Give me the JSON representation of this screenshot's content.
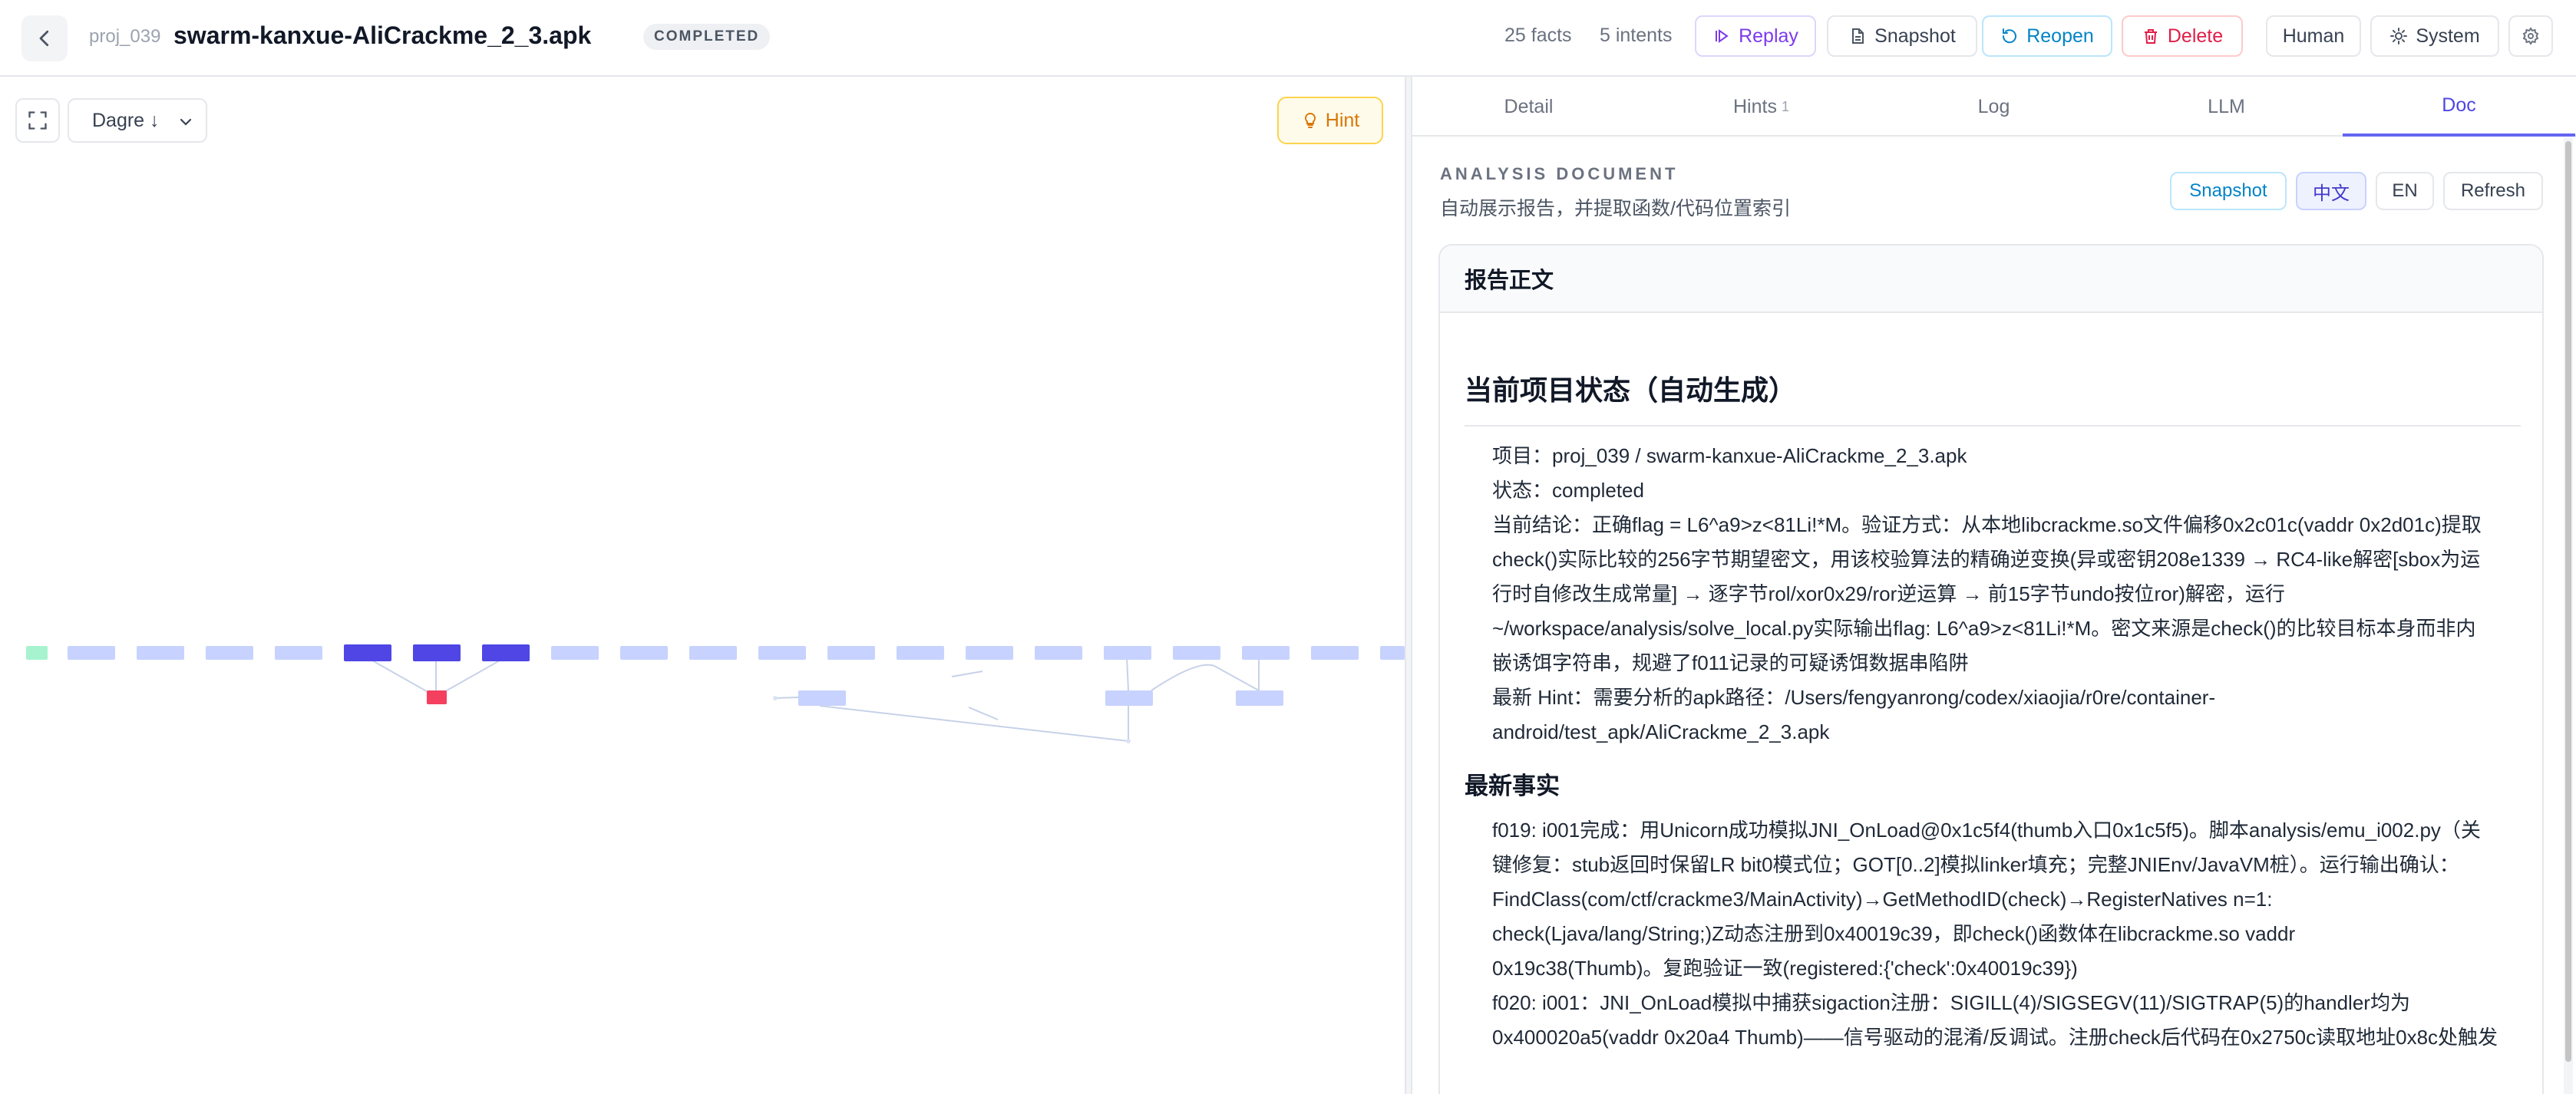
{
  "header": {
    "project_id": "proj_039",
    "title": "swarm-kanxue-AliCrackme_2_3.apk",
    "status": "COMPLETED",
    "facts": "25 facts",
    "intents": "5 intents",
    "replay": "Replay",
    "snapshot": "Snapshot",
    "reopen": "Reopen",
    "delete": "Delete",
    "human": "Human",
    "system": "System"
  },
  "graph": {
    "layout": "Dagre ↓",
    "hint": "Hint"
  },
  "tabs": [
    {
      "label": "Detail",
      "count": ""
    },
    {
      "label": "Hints",
      "count": "1"
    },
    {
      "label": "Log",
      "count": ""
    },
    {
      "label": "LLM",
      "count": ""
    },
    {
      "label": "Doc",
      "count": ""
    }
  ],
  "doc": {
    "label": "ANALYSIS DOCUMENT",
    "subtitle": "自动展示报告，并提取函数/代码位置索引",
    "snapshot": "Snapshot",
    "lang_zh": "中文",
    "lang_en": "EN",
    "refresh": "Refresh",
    "report_title": "报告正文",
    "section1_title": "当前项目状态（自动生成）",
    "section1_lines": [
      "项目：proj_039 / swarm-kanxue-AliCrackme_2_3.apk",
      "状态：completed",
      "当前结论：正确flag = L6^a9>z<81Li!*M。验证方式：从本地libcrackme.so文件偏移0x2c01c(vaddr 0x2d01c)提取",
      "check()实际比较的256字节期望密文，用该校验算法的精确逆变换(异或密钥208e1339 → RC4-like解密[sbox为运",
      "行时自修改生成常量] → 逐字节rol/xor0x29/ror逆运算 → 前15字节undo按位ror)解密，运行",
      "~/workspace/analysis/solve_local.py实际输出flag: L6^a9>z<81Li!*M。密文来源是check()的比较目标本身而非内",
      "嵌诱饵字符串，规避了f011记录的可疑诱饵数据串陷阱",
      "最新 Hint：需要分析的apk路径：/Users/fengyanrong/codex/xiaojia/r0re/container-",
      "android/test_apk/AliCrackme_2_3.apk"
    ],
    "section2_title": "最新事实",
    "section2_lines": [
      "f019: i001完成：用Unicorn成功模拟JNI_OnLoad@0x1c5f4(thumb入口0x1c5f5)。脚本analysis/emu_i002.py（关",
      "键修复：stub返回时保留LR bit0模式位；GOT[0..2]模拟linker填充；完整JNIEnv/JavaVM桩）。运行输出确认：",
      "FindClass(com/ctf/crackme3/MainActivity)→GetMethodID(check)→RegisterNatives n=1:",
      "check(Ljava/lang/String;)Z动态注册到0x40019c39，即check()函数体在libcrackme.so vaddr",
      "0x19c38(Thumb)。复跑验证一致(registered:{'check':0x40019c39})",
      "f020: i001：JNI_OnLoad模拟中捕获sigaction注册：SIGILL(4)/SIGSEGV(11)/SIGTRAP(5)的handler均为",
      "0x400020a5(vaddr 0x20a4 Thumb)——信号驱动的混淆/反调试。注册check后代码在0x2750c读取地址0x8c处触发"
    ]
  }
}
